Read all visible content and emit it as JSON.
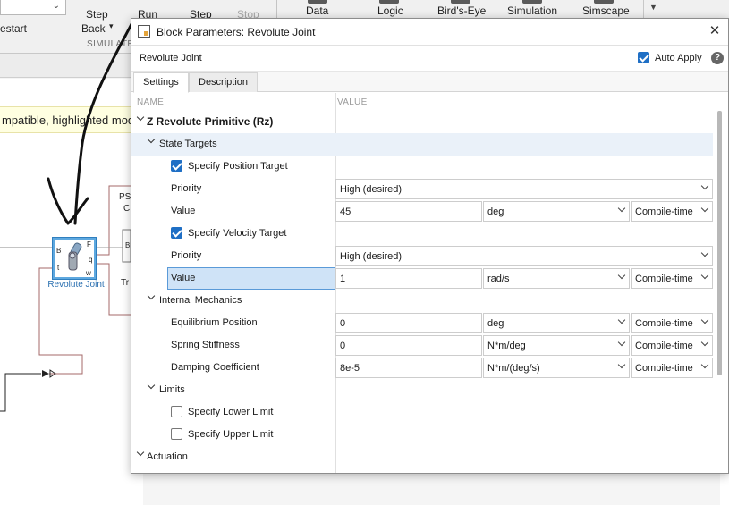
{
  "toolstrip": {
    "restart_label": "estart",
    "step_back_label_1": "Step",
    "step_back_label_2": "Back",
    "run_label": "Run",
    "step_fwd_label": "Step",
    "stop_label": "Stop",
    "section_label": "SIMULATE",
    "apps": [
      "Data",
      "Logic",
      "Bird's-Eye",
      "Simulation",
      "Simscape"
    ]
  },
  "canvas": {
    "banner_text": "mpatible, highlighted mod",
    "block_label": "Revolute Joint",
    "block_ports": {
      "b": "B",
      "f": "F",
      "q": "q",
      "t": "t",
      "w": "w"
    },
    "ps_text_1": "PS",
    "ps_text_2": "C",
    "ps_text_3": "Tr",
    "b_port_right": "B"
  },
  "dialog": {
    "title": "Block Parameters: Revolute Joint",
    "block_name": "Revolute Joint",
    "auto_apply_label": "Auto Apply",
    "auto_apply_checked": true,
    "help_glyph": "?",
    "close_glyph": "✕",
    "tabs": [
      "Settings",
      "Description"
    ],
    "active_tab": "Settings",
    "col_name": "NAME",
    "col_value": "VALUE",
    "primitive": "Z Revolute Primitive (Rz)",
    "state_targets": "State Targets",
    "spec_pos": {
      "label": "Specify Position Target",
      "checked": true
    },
    "pos_priority": {
      "label": "Priority",
      "value": "High (desired)"
    },
    "pos_value": {
      "label": "Value",
      "value": "45",
      "unit": "deg",
      "mode": "Compile-time"
    },
    "spec_vel": {
      "label": "Specify Velocity Target",
      "checked": true
    },
    "vel_priority": {
      "label": "Priority",
      "value": "High (desired)"
    },
    "vel_value": {
      "label": "Value",
      "value": "1",
      "unit": "rad/s",
      "mode": "Compile-time"
    },
    "internal_mechanics": "Internal Mechanics",
    "eq_pos": {
      "label": "Equilibrium Position",
      "value": "0",
      "unit": "deg",
      "mode": "Compile-time"
    },
    "spring": {
      "label": "Spring Stiffness",
      "value": "0",
      "unit": "N*m/deg",
      "mode": "Compile-time"
    },
    "damping": {
      "label": "Damping Coefficient",
      "value": "8e-5",
      "unit": "N*m/(deg/s)",
      "mode": "Compile-time"
    },
    "limits": "Limits",
    "lower_limit": {
      "label": "Specify Lower Limit",
      "checked": false
    },
    "upper_limit": {
      "label": "Specify Upper Limit",
      "checked": false
    },
    "actuation": "Actuation"
  }
}
